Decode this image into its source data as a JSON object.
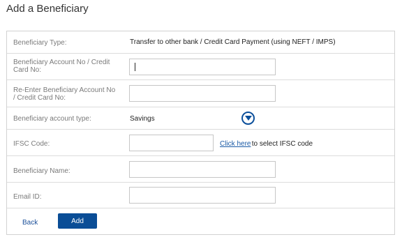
{
  "header": {
    "title": "Add a Beneficiary"
  },
  "form": {
    "beneficiary_type": {
      "label": "Beneficiary Type:",
      "value": "Transfer to other bank / Credit Card Payment (using NEFT / IMPS)"
    },
    "account_no": {
      "label": "Beneficiary Account No / Credit Card No:",
      "value": ""
    },
    "reenter_account_no": {
      "label": "Re-Enter Beneficiary Account No / Credit Card No:",
      "value": ""
    },
    "account_type": {
      "label": "Beneficiary account type:",
      "selected": "Savings",
      "icon": "chevron-down-circle-icon"
    },
    "ifsc": {
      "label": "IFSC Code:",
      "value": "",
      "link_text": "Click here",
      "link_suffix": " to select IFSC code"
    },
    "name": {
      "label": "Beneficiary Name:",
      "value": ""
    },
    "email": {
      "label": "Email ID:",
      "value": ""
    }
  },
  "actions": {
    "back_label": "Back",
    "add_label": "Add"
  },
  "colors": {
    "primary": "#0a4d96",
    "link": "#1a5aa6",
    "label": "#7a7a7a",
    "border": "#d2d2d2"
  }
}
